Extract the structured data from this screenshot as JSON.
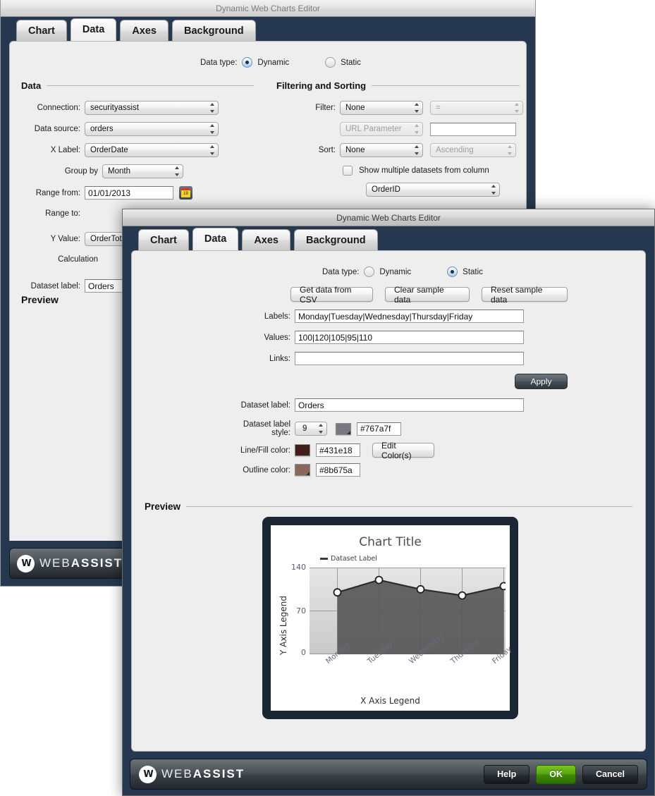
{
  "back_window": {
    "title": "Dynamic Web Charts Editor",
    "tabs": [
      {
        "label": "Chart",
        "active": false
      },
      {
        "label": "Data",
        "active": true
      },
      {
        "label": "Axes",
        "active": false
      },
      {
        "label": "Background",
        "active": false
      }
    ],
    "data_type": {
      "label": "Data type:",
      "dynamic_label": "Dynamic",
      "static_label": "Static",
      "selected": "Dynamic"
    },
    "data_group": {
      "title": "Data",
      "connection_label": "Connection:",
      "connection_value": "securityassist",
      "data_source_label": "Data source:",
      "data_source_value": "orders",
      "x_label_label": "X Label:",
      "x_label_value": "OrderDate",
      "group_by_label": "Group by",
      "group_by_value": "Month",
      "range_from_label": "Range from:",
      "range_from_value": "01/01/2013",
      "calendar_day": "19",
      "range_to_label": "Range to:",
      "y_value_label": "Y Value:",
      "y_value_value": "OrderTotal",
      "calculation_label": "Calculation",
      "dataset_label_label": "Dataset label:",
      "dataset_label_value": "Orders",
      "preview_title": "Preview"
    },
    "filtering_group": {
      "title": "Filtering and Sorting",
      "filter_label": "Filter:",
      "filter_value": "None",
      "operator_value": "=",
      "url_parameter_value": "URL Parameter",
      "filter_text_value": "",
      "sort_label": "Sort:",
      "sort_value": "None",
      "sort_direction_value": "Ascending",
      "multi_dataset_label": "Show  multiple datasets from column",
      "multi_dataset_column": "OrderID"
    },
    "logo": {
      "prefix": "WEB",
      "suffix": "ASSIST",
      "mark": "W"
    }
  },
  "front_window": {
    "title": "Dynamic Web Charts Editor",
    "tabs": [
      {
        "label": "Chart",
        "active": false
      },
      {
        "label": "Data",
        "active": true
      },
      {
        "label": "Axes",
        "active": false
      },
      {
        "label": "Background",
        "active": false
      }
    ],
    "data_type": {
      "label": "Data type:",
      "dynamic_label": "Dynamic",
      "static_label": "Static",
      "selected": "Static"
    },
    "buttons": {
      "get_csv": "Get data from CSV",
      "clear_sample": "Clear sample data",
      "reset_sample": "Reset sample data",
      "apply": "Apply",
      "edit_colors": "Edit Color(s)"
    },
    "fields": {
      "labels_label": "Labels:",
      "labels_value": "Monday|Tuesday|Wednesday|Thursday|Friday",
      "values_label": "Values:",
      "values_value": "100|120|105|95|110",
      "links_label": "Links:",
      "links_value": "",
      "links_placeholder": "",
      "dataset_label_label": "Dataset label:",
      "dataset_label_value": "Orders",
      "dataset_style_label": "Dataset label style:",
      "dataset_style_size": "9",
      "dataset_style_color": "#767a7f",
      "line_fill_label": "Line/Fill color:",
      "line_fill_color": "#431e18",
      "outline_label": "Outline color:",
      "outline_color": "#8b675a"
    },
    "preview_title": "Preview",
    "footer": {
      "help": "Help",
      "ok": "OK",
      "cancel": "Cancel",
      "logo_prefix": "WEB",
      "logo_suffix": "ASSIST",
      "logo_mark": "W"
    }
  },
  "chart_data": {
    "type": "area",
    "title": "Chart Title",
    "xlabel": "X Axis Legend",
    "ylabel": "Y Axis Legend",
    "legend": [
      "Dataset Label"
    ],
    "legend_position": "top-left",
    "categories": [
      "Monday",
      "Tuesday",
      "Wednesday",
      "Thursday",
      "Friday"
    ],
    "values": [
      100,
      120,
      105,
      95,
      110
    ],
    "yticks": [
      0,
      70,
      140
    ],
    "ylim": [
      0,
      140
    ],
    "grid": true,
    "fill_color": "#565656",
    "line_color": "#2e2e2e",
    "marker_color": "#ffffff",
    "plot_bg": "#dcdcdc"
  }
}
